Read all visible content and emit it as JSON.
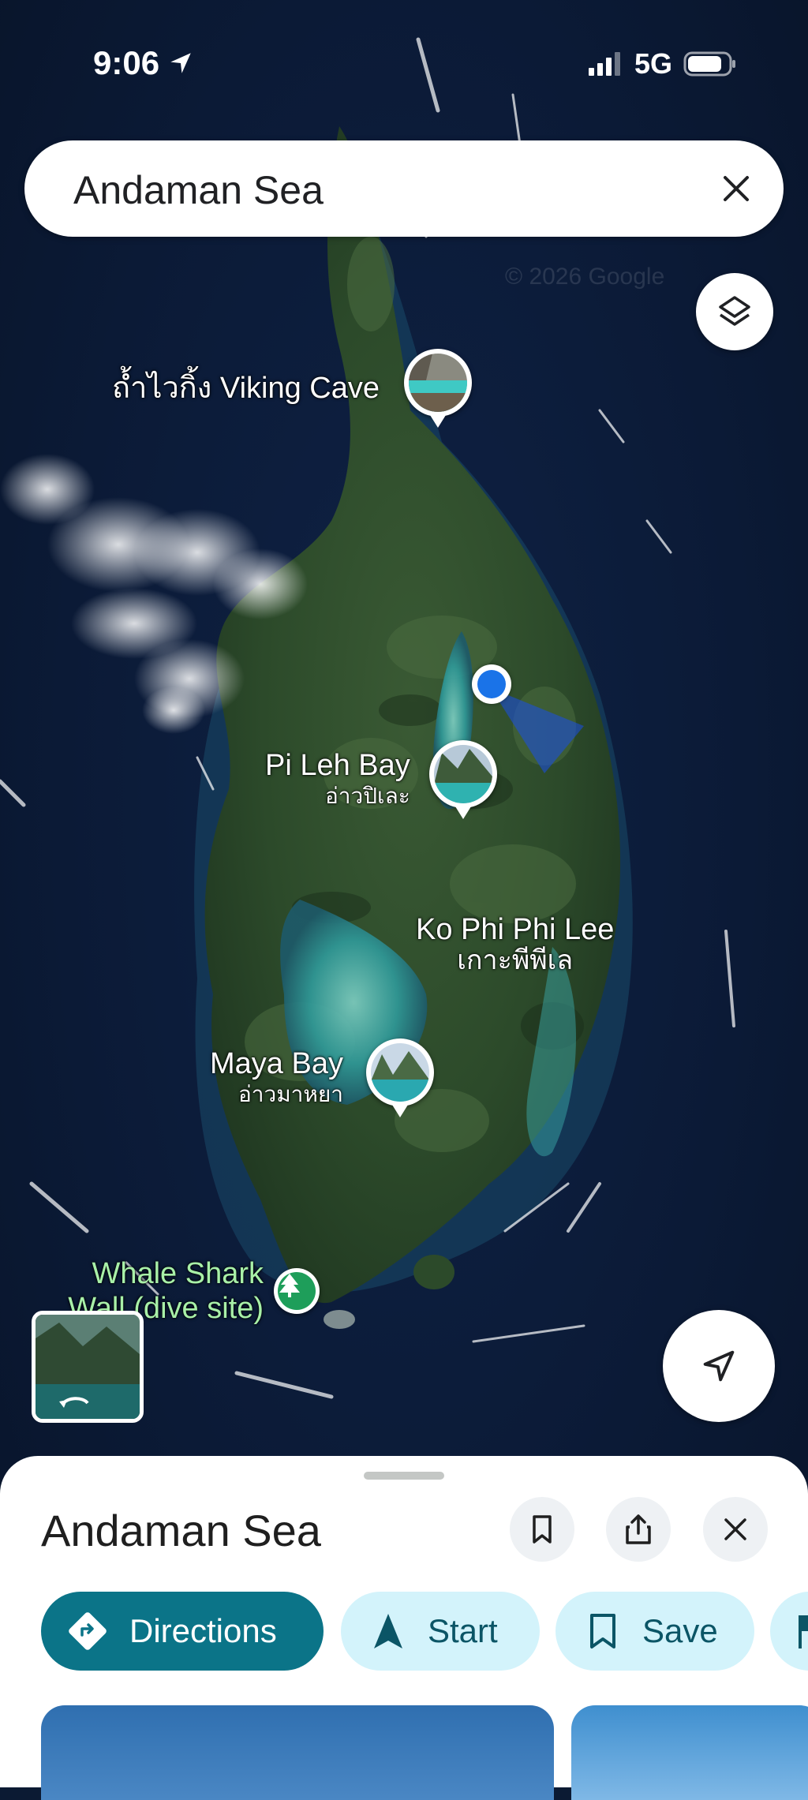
{
  "status_bar": {
    "time": "9:06",
    "network": "5G"
  },
  "search": {
    "query": "Andaman Sea"
  },
  "map": {
    "labels": {
      "viking_cave": "ถ้ำไวกิ้ง Viking Cave",
      "pi_leh_bay": "Pi Leh Bay",
      "pi_leh_bay_thai": "อ่าวปิเละ",
      "ko_phi_phi_lee": "Ko Phi Phi Lee",
      "ko_phi_phi_lee_thai": "เกาะพีพีเล",
      "maya_bay": "Maya Bay",
      "maya_bay_thai": "อ่าวมาหยา",
      "whale_shark_wall": "Whale Shark Wall (dive site)"
    },
    "watermarks": [
      "© 2026 Google"
    ]
  },
  "sheet": {
    "title": "Andaman Sea",
    "chips": {
      "directions": "Directions",
      "start": "Start",
      "save": "Save"
    }
  },
  "colors": {
    "primary_chip": "#0b7488",
    "secondary_chip": "#d3f3fb",
    "location_blue": "#1a73e8",
    "park_green": "#1e9e5a"
  }
}
